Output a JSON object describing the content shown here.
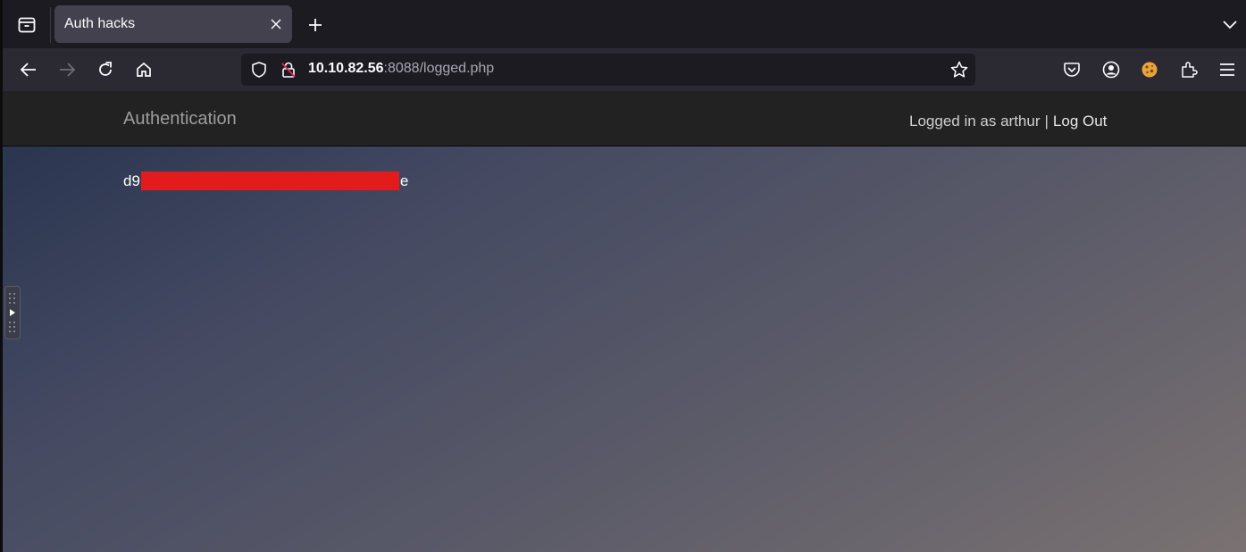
{
  "browser": {
    "tab_title": "Auth hacks",
    "url_host": "10.10.82.56",
    "url_rest": ":8088/logged.php"
  },
  "page": {
    "brand": "Authentication",
    "logged_in_text": "Logged in as arthur",
    "separator": "|",
    "logout_label": "Log Out",
    "secret_prefix": "d9",
    "secret_suffix": "e"
  },
  "colors": {
    "redaction": "#e41b1c",
    "navbar_bg": "#222222"
  },
  "icons": [
    "tab-list-icon",
    "close-icon",
    "plus-icon",
    "chevron-down-icon",
    "back-icon",
    "forward-icon",
    "reload-icon",
    "home-icon",
    "shield-icon",
    "insecure-lock-icon",
    "star-icon",
    "pocket-icon",
    "account-icon",
    "extension-cookie-icon",
    "extensions-icon",
    "menu-icon"
  ]
}
